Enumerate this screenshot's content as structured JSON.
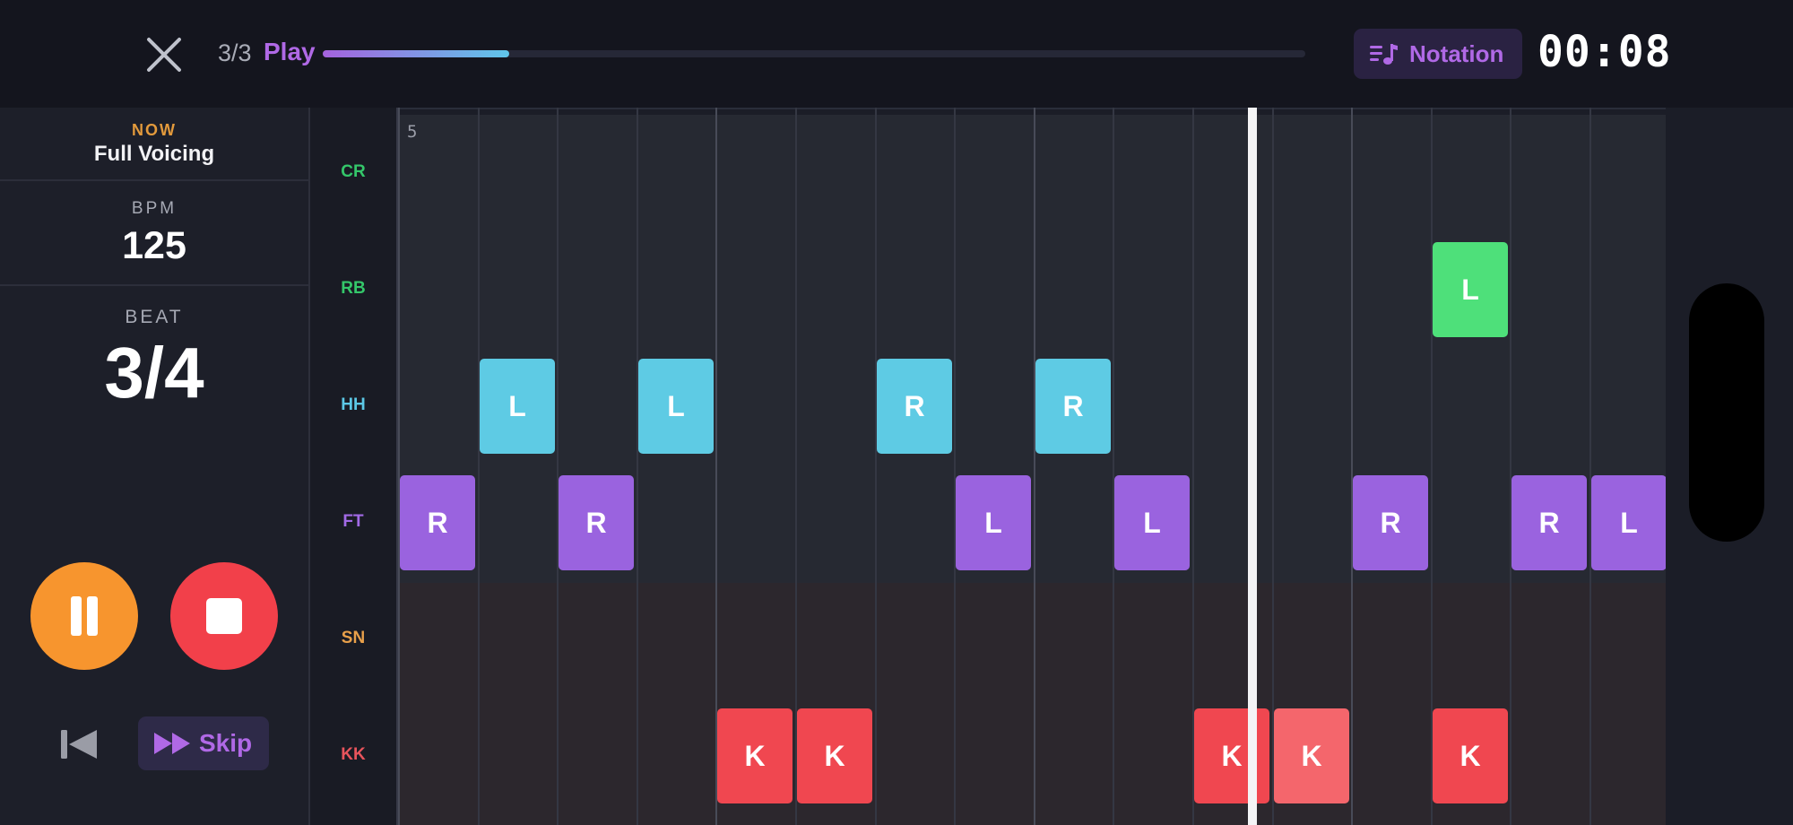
{
  "header": {
    "counter": "3/3",
    "mode": "Play",
    "progress": 0.19,
    "notation_label": "Notation",
    "timer": "00:08"
  },
  "panel": {
    "now_label": "NOW",
    "section_name": "Full Voicing",
    "bpm_label": "BPM",
    "bpm": "125",
    "beat_label": "BEAT",
    "beat": "3/4",
    "skip_label": "Skip"
  },
  "grid": {
    "bar_number": "5",
    "steps": 16,
    "playhead_step": 10.7,
    "instruments": [
      {
        "id": "CR",
        "color": "#34c76a"
      },
      {
        "id": "RB",
        "color": "#34c76a"
      },
      {
        "id": "HH",
        "color": "#5cc8e6"
      },
      {
        "id": "FT",
        "color": "#a26ae6"
      },
      {
        "id": "SN",
        "color": "#e8a04a"
      },
      {
        "id": "KK",
        "color": "#e8545c"
      }
    ],
    "notes": [
      {
        "row": 1,
        "step": 13,
        "text": "L",
        "color": "#4ee07a"
      },
      {
        "row": 2,
        "step": 1,
        "text": "L",
        "color": "#5ecbe4"
      },
      {
        "row": 2,
        "step": 3,
        "text": "L",
        "color": "#5ecbe4"
      },
      {
        "row": 2,
        "step": 6,
        "text": "R",
        "color": "#5ecbe4"
      },
      {
        "row": 2,
        "step": 8,
        "text": "R",
        "color": "#5ecbe4"
      },
      {
        "row": 3,
        "step": 0,
        "text": "R",
        "color": "#9a63df"
      },
      {
        "row": 3,
        "step": 2,
        "text": "R",
        "color": "#9a63df"
      },
      {
        "row": 3,
        "step": 7,
        "text": "L",
        "color": "#9a63df"
      },
      {
        "row": 3,
        "step": 9,
        "text": "L",
        "color": "#9a63df"
      },
      {
        "row": 3,
        "step": 12,
        "text": "R",
        "color": "#9a63df"
      },
      {
        "row": 3,
        "step": 14,
        "text": "R",
        "color": "#9a63df"
      },
      {
        "row": 3,
        "step": 15,
        "text": "L",
        "color": "#9a63df"
      },
      {
        "row": 5,
        "step": 4,
        "text": "K",
        "color": "#f04750"
      },
      {
        "row": 5,
        "step": 5,
        "text": "K",
        "color": "#f04750"
      },
      {
        "row": 5,
        "step": 10,
        "text": "K",
        "color": "#f04750"
      },
      {
        "row": 5,
        "step": 11,
        "text": "K",
        "color": "#f4666c"
      },
      {
        "row": 5,
        "step": 13,
        "text": "K",
        "color": "#f04750"
      }
    ]
  },
  "icons": {
    "close": "close-icon",
    "notation": "music-notes-icon",
    "pause": "pause-icon",
    "stop": "stop-icon",
    "previous": "skip-back-icon",
    "skip": "fast-forward-icon",
    "debug": "bug-icon"
  }
}
